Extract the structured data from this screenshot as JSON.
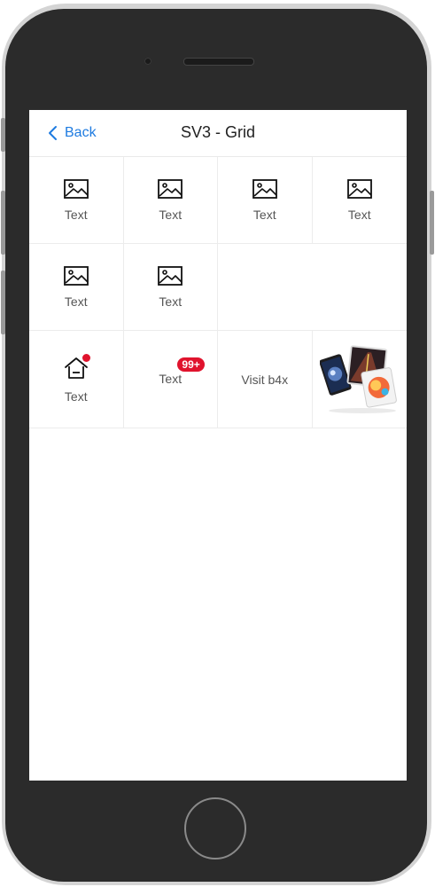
{
  "nav": {
    "back_label": "Back",
    "title": "SV3 - Grid"
  },
  "grid": {
    "row1": [
      "Text",
      "Text",
      "Text",
      "Text"
    ],
    "row2": [
      "Text",
      "Text"
    ],
    "row3": {
      "house_label": "Text",
      "badge_cell_label": "Text",
      "badge_count": "99+",
      "visit_label": "Visit b4x"
    }
  },
  "icons": {
    "grid_icon": "image-icon",
    "house_icon": "house-icon",
    "dot": "notification-dot",
    "back": "chevron-left-icon"
  },
  "colors": {
    "accent": "#1e7be0",
    "badge": "#e0132d"
  }
}
